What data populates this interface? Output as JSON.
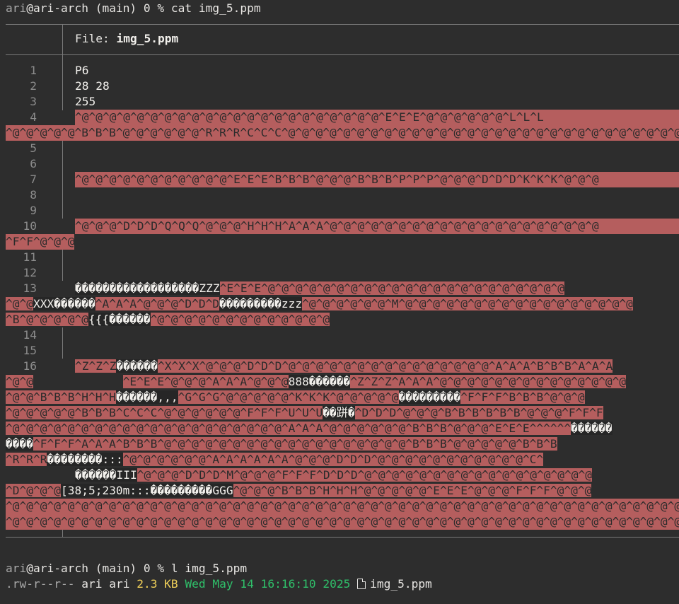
{
  "prompt1": {
    "user": "ari",
    "host_part": "@ari-arch (main) 0 % ",
    "command": "cat img_5.ppm"
  },
  "header": {
    "label": "File: ",
    "filename": "img_5.ppm"
  },
  "lines": {
    "n1": "1",
    "c1": "P6",
    "n2": "2",
    "c2": "28 28",
    "n3": "3",
    "c3": "255",
    "n4": "4",
    "c4": "^@^@^@^@^@^@^@^@^@^@^@^@^@^@^@^@^@^@^@^@^@^@^E^E^E^@^@^@^@^@^@^L^L^L",
    "w4a": "^@^@^@^@^@^B^B^B^@^@^@^@^@^@^R^R^R^C^C^C^@^@^@^@^@^@^@^@^@^@^@^@^@^@^@^@^@^@^@^@^@^@^@^@^@^@^@^@^@^@",
    "n5": "5",
    "n6": "6",
    "n7": "7",
    "c7": "^@^@^@^@^@^@^@^@^@^@^@^E^E^E^B^B^B^@^@^@^B^B^B^P^P^P^@^@^@^D^D^D^K^K^K^@^@^@",
    "n8": "8",
    "n9": "9",
    "n10": "10",
    "c10": "^@^@^@^D^D^D^Q^Q^Q^@^@^@^H^H^H^A^A^A^@^@^@^@^@^@^@^@^@^@^@^@^@^@^@^@^@^@^@^@",
    "w10a": "^F^F^@^@^@",
    "n11": "11",
    "n12": "12",
    "n13": "13",
    "c13_d1": "������������������ZZZ",
    "c13_r1": "^E^E^E^@^@^@^@^@^@^@^@^@^@^@^@^@^@^@^@^@^@^@^@^@^@",
    "w13a_r1": "^@^@",
    "w13a_d1": "XXX������",
    "w13a_r2": "^A^A^A^@^@^@^D^D^D",
    "w13a_d2": "���������zzz",
    "w13a_r3": "^@^@^@^@^@^@^M^@^@^@^@^@^@^@^@^@^@^@^@^@^@^@^@^@",
    "w13b_r1": "^B^@^@^@^@^@",
    "w13b_d1": "{{{������",
    "w13b_r2": "^@^@^@^@^@^@^@^@^@^@^@^@^@",
    "n14": "14",
    "n15": "15",
    "n16": "16",
    "c16_r1": "^Z^Z^Z",
    "c16_d1": "������",
    "c16_r2": "^X^X^X^@^@^@^D^D^D^@^@^@^@^@^@^@^@^@^@^@^@^@^@^@^A^A^A^B^B^B^A^A^A",
    "w16a_r1": "^@^@",
    "w16a_r2": "^E^E^E^@^@^@^A^A^A^@^@^@",
    "w16a_d1": "888������",
    "w16a_r3": "^Z^Z^Z^A^A^A^@^@^@^@^@^@^@^@^@^@^@^@^@^@",
    "w16b_r1": "^@^@^B^B^B^H^H^H",
    "w16b_d1": "������,,,",
    "w16b_r2": "^G^G^G^@^@^@^@^@^K^K^K^@^@^@^@^@",
    "w16b_d2": "���������",
    "w16b_r3": "^F^F^F^B^B^B^@^@^@",
    "w16c_r1": "^@^@^@^@^@^B^B^B^C^C^C^@^@^@^@^@^@^F^F^F^U^U^U",
    "w16c_d1": "��跰�",
    "w16c_r2": "^D^D^D^@^@^@^B^B^B^B^B^B^@^@^@^F^F^F",
    "w16d_r1": "^@^@^@^@^@^@^@^@^@^@^@^@^@^@^@^@^@^@^@^@^A^A^A^@^@^@^@^@^@^B^B^B^@^@^@^E^E^E^^^^^^",
    "w16d_d1": "������",
    "w16e_d1": "����",
    "w16e_r1": "^F^F^F^A^A^A^B^B^B^@^@^@^@^@^@^@^@^@^@^@^@^@^@^@^@^@^@^B^B^B^@^@^@^@^@^B^B^B",
    "w16f_r1": "^R^R^R",
    "w16f_d1": "��������:::",
    "w16f_r2": "^@^@^@^@^@^@^A^A^A^A^A^A^@^@^@^D^D^D^@^@^@^@^@^@^@^@^@^@^@^C^",
    "w16g_d1": "������III",
    "w16g_r1": "^@^@^@^D^D^D^M^@^@^@^F^F^F^D^D^D^@^@^@^@^@^@^@^@^@^@^@^@^@^@^@^@^@",
    "w16h_r1": "^D^@^@^@",
    "w16h_d1": "[38;5;230m:::���������GGG",
    "w16h_r2": "^@^@^@^B^B^B^H^H^H^@^@^@^@^@^E^E^E^@^@^@^F^F^F^@^@^@",
    "w16i_r1": "^@^@^@^@^@^@^@^@^@^@^@^@^@^@^@^@^@^@^@^@^@^@^@^@^@^@^@^@^@^@^@^@^@^@^@^@^@^@^@^@^@^@^@^@^@^@^@^@^@^@",
    "w16j_r1": "^@^@^@^@^@^@^@^@^@^@^@^@^@^@^@^@^@^@^@^@^@^@^@^@^@^@^@^@^@^@^@^@^@^@^@^@^@^@^@^@^@^@^@^@^@^@^@^@^@^@"
  },
  "prompt2": {
    "user": "ari",
    "host_part": "@ari-arch (main) 0 % ",
    "command": "l img_5.ppm"
  },
  "listing": {
    "permissions": ".rw-r--r--",
    "owner": "ari ari",
    "size": "2.3 KB",
    "date": "Wed May 14 16:16:10 2025",
    "icon": "file-icon",
    "filename": "img_5.ppm"
  },
  "colors": {
    "highlight": "#b55e5e",
    "date": "#2fc06a",
    "size": "#f1d15a",
    "background": "#2d2d2d"
  }
}
